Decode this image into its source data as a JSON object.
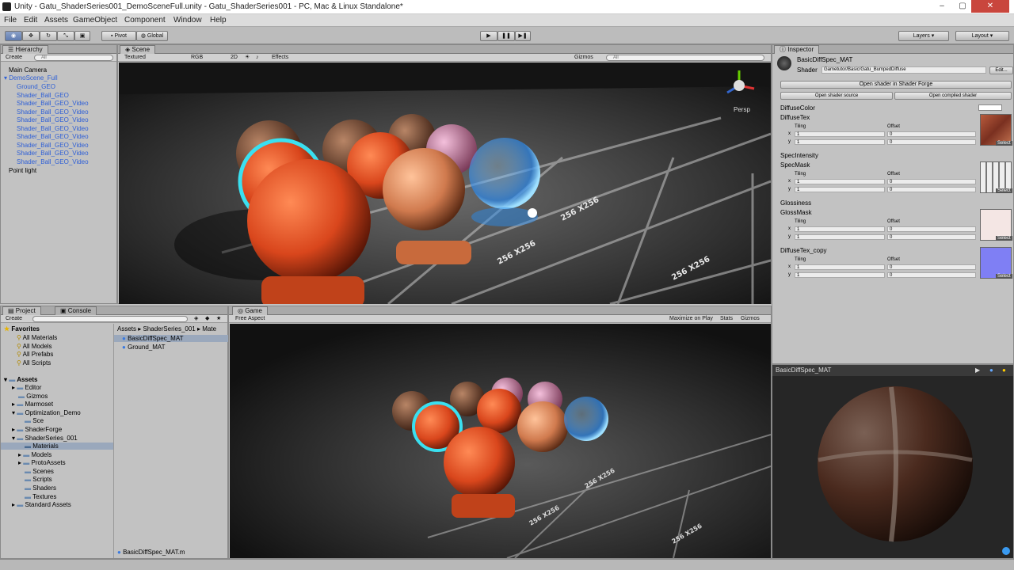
{
  "window": {
    "title": "Unity - Gatu_ShaderSeries001_DemoSceneFull.unity - Gatu_ShaderSeries001 - PC, Mac & Linux Standalone*"
  },
  "menu": [
    "File",
    "Edit",
    "Assets",
    "GameObject",
    "Component",
    "Window",
    "Help"
  ],
  "toolbar": {
    "pivot": "Pivot",
    "global": "Global",
    "layers": "Layers",
    "layout": "Layout"
  },
  "hierarchy": {
    "tab": "Hierarchy",
    "create": "Create",
    "search": "All",
    "items": [
      "Main Camera",
      "DemoScene_Full",
      "Ground_GEO",
      "Shader_Ball_GEO",
      "Shader_Ball_GEO_Video",
      "Shader_Ball_GEO_Video",
      "Shader_Ball_GEO_Video",
      "Shader_Ball_GEO_Video",
      "Shader_Ball_GEO_Video",
      "Shader_Ball_GEO_Video",
      "Shader_Ball_GEO_Video",
      "Shader_Ball_GEO_Video",
      "Point light"
    ]
  },
  "scene": {
    "tab": "Scene",
    "mode": "Textured",
    "rgb": "RGB",
    "twod": "2D",
    "effects": "Effects",
    "gizmos": "Gizmos",
    "search": "All",
    "persp": "Persp",
    "grid_labels": [
      "256 X256",
      "256 X256",
      "256 X256",
      "256 X256",
      "256 X256",
      "256 X256"
    ]
  },
  "inspector": {
    "tab": "Inspector",
    "material": "BasicDiffSpec_MAT",
    "shader_label": "Shader",
    "shader": "Gametutor/Basic/Gatu_BumpedDiffuse",
    "edit": "Edit...",
    "open_shader_forge": "Open shader in Shader Forge",
    "open_source": "Open shader source",
    "open_compiled": "Open compiled shader",
    "props": [
      {
        "name": "DiffuseColor"
      },
      {
        "name": "DiffuseTex",
        "tiling_x": "1",
        "tiling_y": "1",
        "offset_x": "0",
        "offset_y": "0"
      },
      {
        "name": "SpecIntensity"
      },
      {
        "name": "SpecMask",
        "tiling_x": "1",
        "tiling_y": "1",
        "offset_x": "0",
        "offset_y": "0"
      },
      {
        "name": "Glossiness"
      },
      {
        "name": "GlossMask",
        "tiling_x": "1",
        "tiling_y": "1",
        "offset_x": "0",
        "offset_y": "0"
      },
      {
        "name": "DiffuseTex_copy",
        "tiling_x": "1",
        "tiling_y": "1",
        "offset_x": "0",
        "offset_y": "0"
      }
    ],
    "tiling": "Tiling",
    "offset": "Offset",
    "x": "x",
    "y": "y",
    "select": "Select",
    "preview_title": "BasicDiffSpec_MAT"
  },
  "project": {
    "tab": "Project",
    "console": "Console",
    "create": "Create",
    "favorites": "Favorites",
    "fav_items": [
      "All Materials",
      "All Models",
      "All Prefabs",
      "All Scripts"
    ],
    "assets": "Assets",
    "folders": [
      "Editor",
      "Gizmos",
      "Marmoset",
      "Optimization_Demo",
      "Sce",
      "ShaderForge",
      "ShaderSeries_001",
      "Materials",
      "Models",
      "ProtoAssets",
      "Scenes",
      "Scripts",
      "Shaders",
      "Textures",
      "Standard Assets"
    ],
    "breadcrumb": [
      "Assets",
      "ShaderSeries_001",
      "Mate"
    ],
    "files": [
      "BasicDiffSpec_MAT",
      "Ground_MAT"
    ],
    "selected_footer": "BasicDiffSpec_MAT.m"
  },
  "game": {
    "tab": "Game",
    "aspect": "Free Aspect",
    "maximize": "Maximize on Play",
    "stats": "Stats",
    "gizmos": "Gizmos",
    "grid_labels": [
      "256 X256",
      "256 X256",
      "256 X256"
    ]
  }
}
